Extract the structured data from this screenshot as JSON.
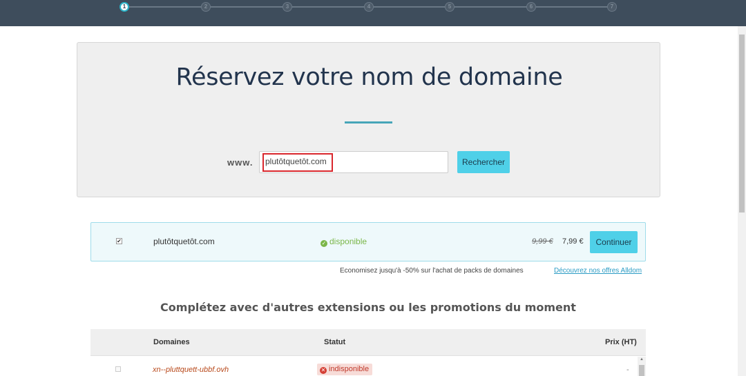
{
  "stepper": {
    "steps": [
      "1",
      "2",
      "3",
      "4",
      "5",
      "6",
      "7"
    ],
    "active_index": 0
  },
  "hero": {
    "title": "Réservez votre nom de domaine",
    "www_label": "www.",
    "search_value": "plutôtquetôt.com",
    "search_button": "Rechercher"
  },
  "result": {
    "checked": true,
    "domain": "plutôtquetôt.com",
    "status": "disponible",
    "old_price": "9,99 €",
    "price": "7,99 €",
    "button": "Continuer"
  },
  "promo": {
    "text": "Economisez jusqu'à -50% sur l'achat de packs de domaines",
    "link": "Découvrez nos offres Alldom"
  },
  "extensions": {
    "title": "Complétez avec d'autres extensions ou les promotions du moment",
    "columns": [
      "Domaines",
      "Statut",
      "Prix (HT)"
    ],
    "rows": [
      {
        "domain": "xn--pluttquett-ubbf.ovh",
        "status": "indisponible",
        "price": "-"
      }
    ]
  },
  "colors": {
    "topbar": "#3e4d5c",
    "accent": "#4fd0e8",
    "available": "#7ab648",
    "unavailable": "#c0392b",
    "highlight": "#d9262c"
  }
}
